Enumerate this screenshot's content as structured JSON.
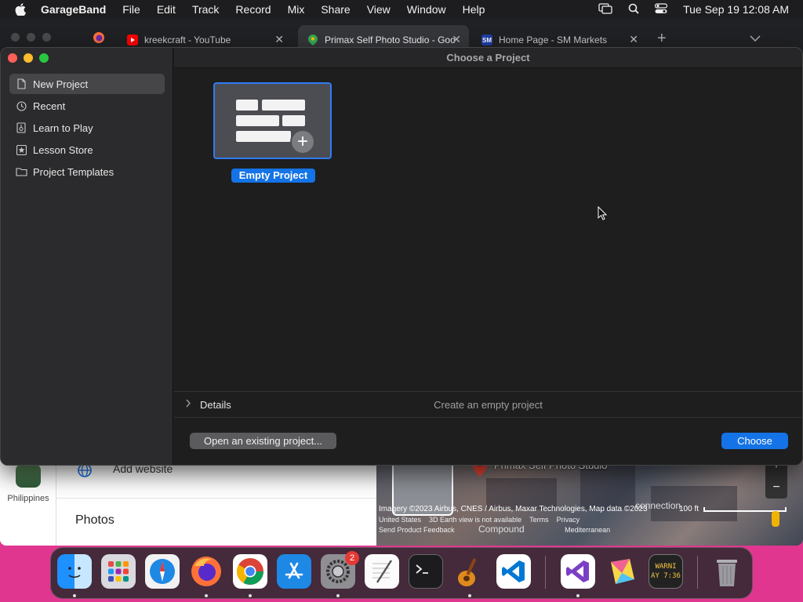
{
  "menubar": {
    "app_name": "GarageBand",
    "menus": [
      "File",
      "Edit",
      "Track",
      "Record",
      "Mix",
      "Share",
      "View",
      "Window",
      "Help"
    ],
    "clock": "Tue Sep 19  12:08 AM"
  },
  "browser": {
    "tabs": [
      {
        "title": "kreekcraft - YouTube",
        "active": false
      },
      {
        "title": "Primax Self Photo Studio - Goo",
        "active": true
      },
      {
        "title": "Home Page - SM Markets",
        "active": false
      }
    ],
    "page": {
      "country": "Philippines",
      "add_website": "Add website",
      "photos_heading": "Photos"
    },
    "map": {
      "place_label": "Primax Self Photo Studio",
      "zoom_in": "+",
      "zoom_out": "−",
      "attribution": "Imagery ©2023 Airbus, CNES / Airbus, Maxar Technologies, Map data ©2023",
      "scale": "100 ft",
      "region": "United States",
      "earth_note": "3D Earth view is not available",
      "terms": "Terms",
      "privacy": "Privacy",
      "feedback": "Send Product Feedback",
      "road_text": "connection",
      "compound_text": "Compound",
      "mediterranean": "Mediterranean"
    }
  },
  "garageband": {
    "window_title": "Choose a Project",
    "sidebar": [
      {
        "label": "New Project",
        "icon": "document-icon",
        "selected": true
      },
      {
        "label": "Recent",
        "icon": "clock-icon",
        "selected": false
      },
      {
        "label": "Learn to Play",
        "icon": "guitar-book-icon",
        "selected": false
      },
      {
        "label": "Lesson Store",
        "icon": "star-store-icon",
        "selected": false
      },
      {
        "label": "Project Templates",
        "icon": "folder-icon",
        "selected": false
      }
    ],
    "project": {
      "label": "Empty Project"
    },
    "details": {
      "label": "Details",
      "description": "Create an empty project"
    },
    "buttons": {
      "open_existing": "Open an existing project...",
      "choose": "Choose"
    }
  },
  "dock": {
    "apps": [
      "Finder",
      "Launchpad",
      "Safari",
      "Firefox",
      "Google Chrome",
      "App Store",
      "System Settings",
      "TextEdit",
      "Terminal",
      "GarageBand",
      "Visual Studio Code",
      "Visual Studio",
      "Pixelmator",
      "Console",
      "Trash"
    ],
    "settings_badge": "2",
    "console_text": "WARNI AY 7:36"
  },
  "colors": {
    "accent": "#1473e6",
    "selection_border": "#2e7cf6",
    "desktop": "#e0368f"
  }
}
